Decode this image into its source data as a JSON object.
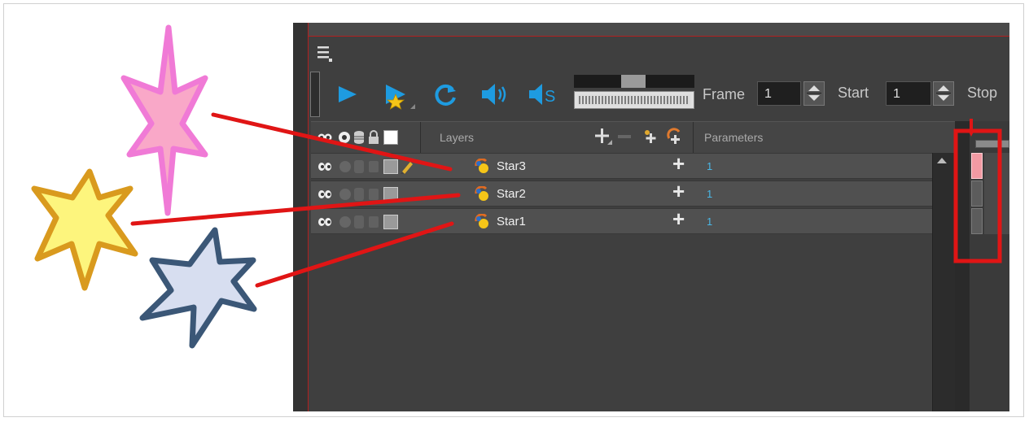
{
  "toolbar": {
    "frame_label": "Frame",
    "frame_value": "1",
    "start_label": "Start",
    "start_value": "1",
    "stop_label": "Stop",
    "icons": [
      "menu-icon",
      "play-icon",
      "render-play-icon",
      "loop-icon",
      "sound-icon",
      "sound-scrub-icon"
    ]
  },
  "header": {
    "layers_label": "Layers",
    "parameters_label": "Parameters"
  },
  "layers": [
    {
      "name": "Star3",
      "value": "1",
      "selected": true
    },
    {
      "name": "Star2",
      "value": "1",
      "selected": false
    },
    {
      "name": "Star1",
      "value": "1",
      "selected": false
    }
  ],
  "stars": [
    {
      "name": "pink-star",
      "fill": "#f9a8c8",
      "stroke": "#f07ad6"
    },
    {
      "name": "yellow-star",
      "fill": "#fdf57d",
      "stroke": "#d99a1e"
    },
    {
      "name": "blue-star",
      "fill": "#d7def0",
      "stroke": "#3b5777"
    }
  ],
  "colors": {
    "panel_bg": "#3f3f3f",
    "row_bg": "#505050",
    "accent_blue": "#1e9be0",
    "value_blue": "#4ab7e6",
    "callout_red": "#e01515"
  }
}
